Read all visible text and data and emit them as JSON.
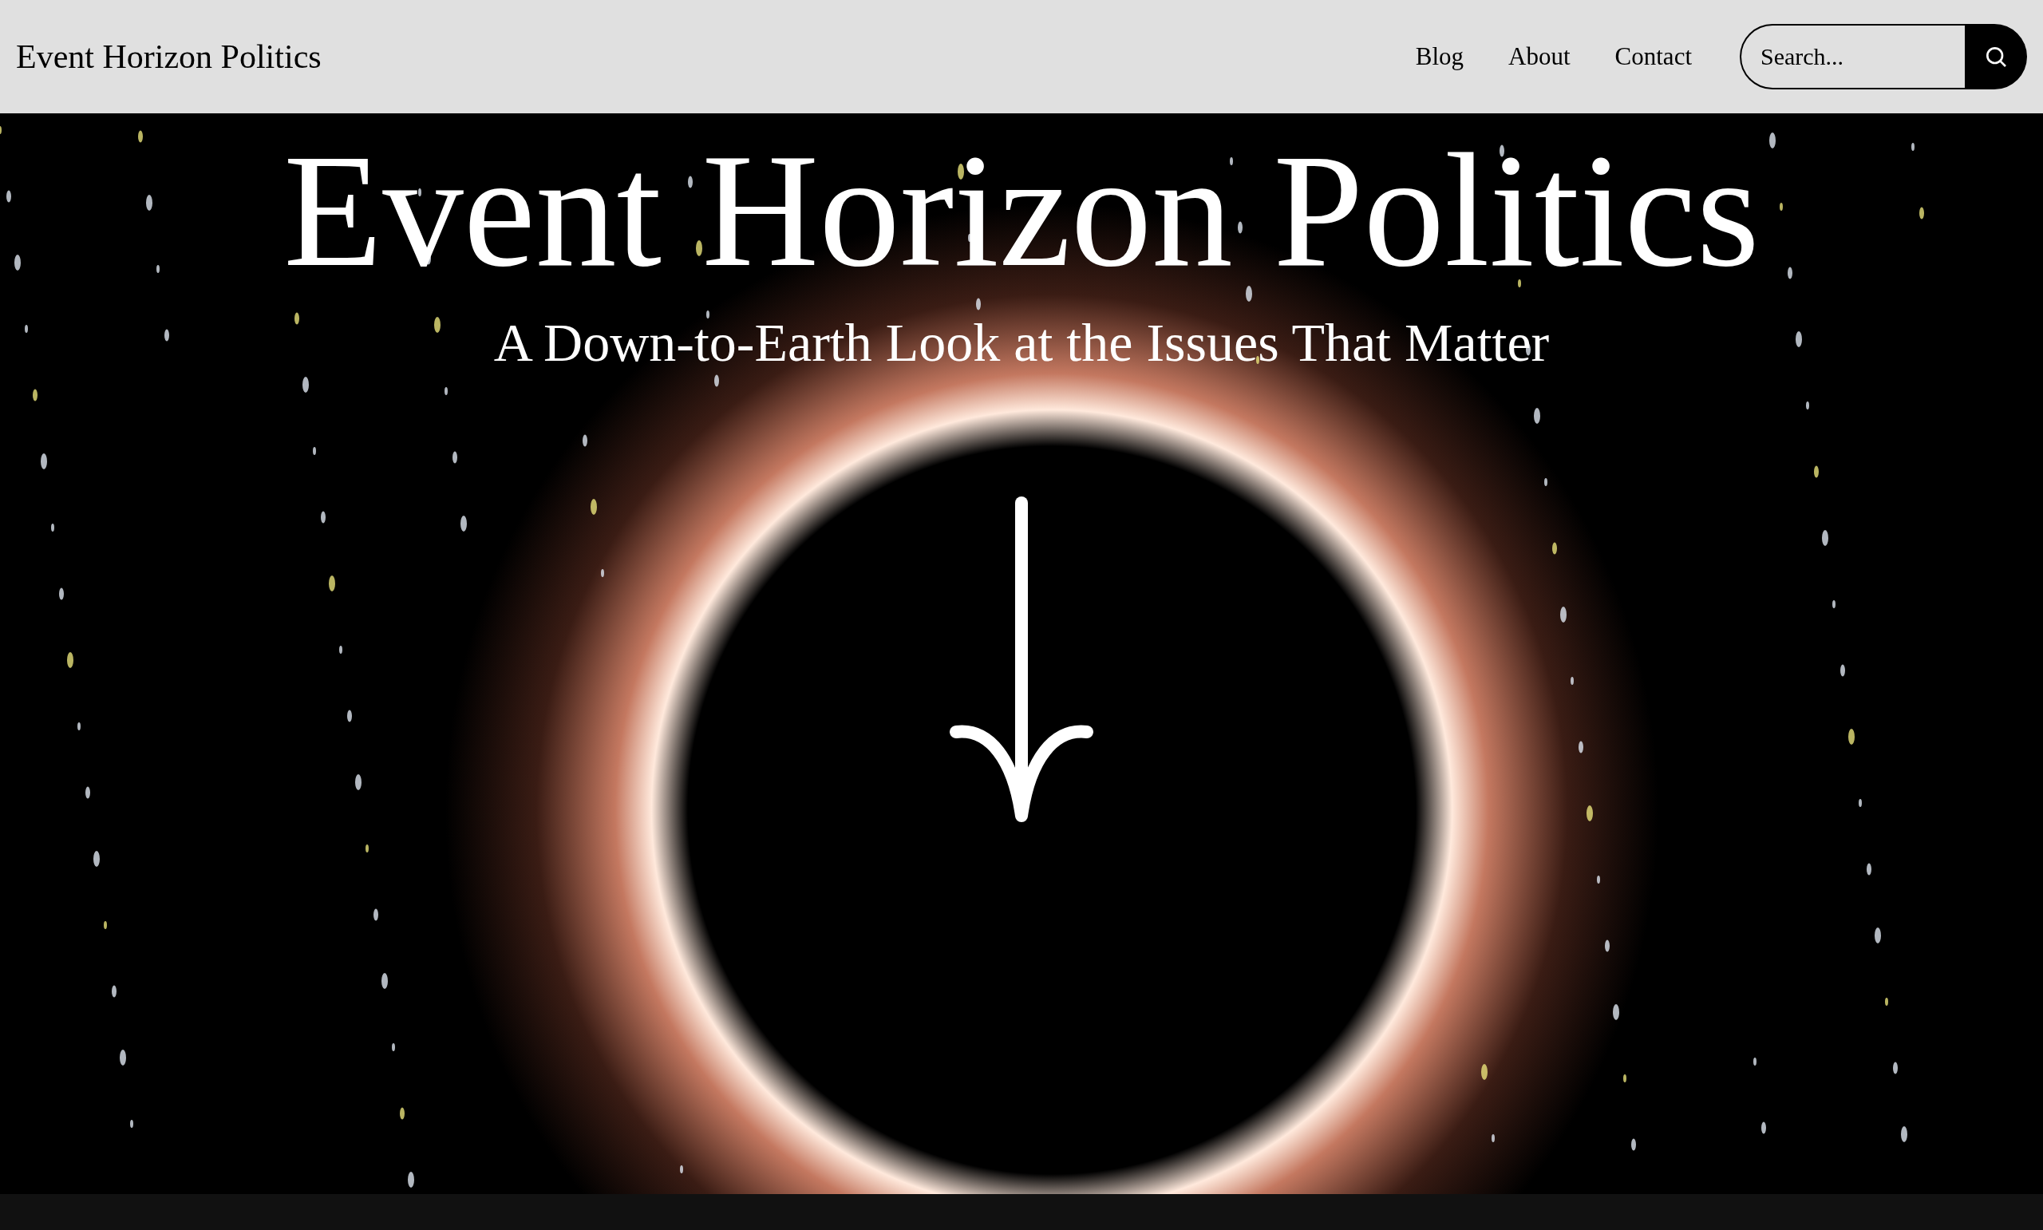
{
  "header": {
    "site_title": "Event Horizon Politics",
    "nav": [
      {
        "label": "Blog"
      },
      {
        "label": "About"
      },
      {
        "label": "Contact"
      }
    ],
    "search": {
      "placeholder": "Search..."
    }
  },
  "hero": {
    "title": "Event Horizon Politics",
    "subtitle": "A Down-to-Earth Look at the Issues That Matter"
  }
}
